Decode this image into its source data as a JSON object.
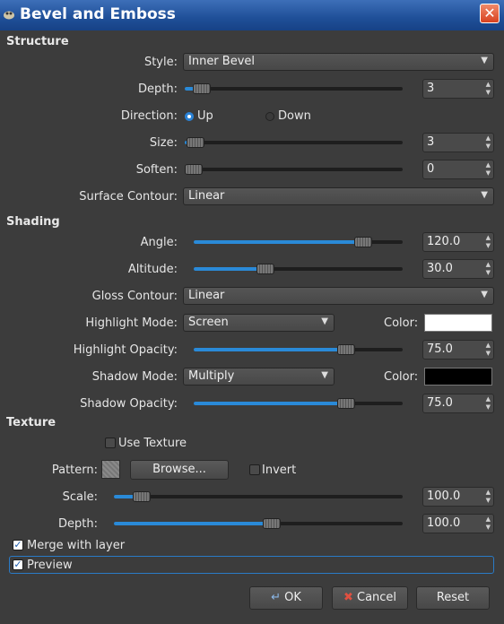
{
  "window": {
    "title": "Bevel and Emboss",
    "close_label": "✕"
  },
  "structure": {
    "heading": "Structure",
    "style_label": "Style:",
    "style_value": "Inner Bevel",
    "depth_label": "Depth:",
    "depth_value": "3",
    "depth_fraction": 0.04,
    "direction_label": "Direction:",
    "direction_up": "Up",
    "direction_down": "Down",
    "direction_selected": "Up",
    "size_label": "Size:",
    "size_value": "3",
    "size_fraction": 0.01,
    "soften_label": "Soften:",
    "soften_value": "0",
    "soften_fraction": 0.0,
    "surface_contour_label": "Surface Contour:",
    "surface_contour_value": "Linear"
  },
  "shading": {
    "heading": "Shading",
    "angle_label": "Angle:",
    "angle_value": "120.0",
    "angle_fraction": 0.84,
    "altitude_label": "Altitude:",
    "altitude_value": "30.0",
    "altitude_fraction": 0.33,
    "gloss_contour_label": "Gloss Contour:",
    "gloss_contour_value": "Linear",
    "highlight_mode_label": "Highlight Mode:",
    "highlight_mode_value": "Screen",
    "highlight_color_label": "Color:",
    "highlight_color": "#ffffff",
    "highlight_opacity_label": "Highlight Opacity:",
    "highlight_opacity_value": "75.0",
    "highlight_opacity_fraction": 0.75,
    "shadow_mode_label": "Shadow Mode:",
    "shadow_mode_value": "Multiply",
    "shadow_color_label": "Color:",
    "shadow_color": "#000000",
    "shadow_opacity_label": "Shadow Opacity:",
    "shadow_opacity_value": "75.0",
    "shadow_opacity_fraction": 0.75
  },
  "texture": {
    "heading": "Texture",
    "use_texture_label": "Use Texture",
    "use_texture_checked": false,
    "pattern_label": "Pattern:",
    "browse_label": "Browse...",
    "invert_label": "Invert",
    "invert_checked": false,
    "scale_label": "Scale:",
    "scale_value": "100.0",
    "scale_fraction": 0.07,
    "depth_label": "Depth:",
    "depth_value": "100.0",
    "depth_fraction": 0.55
  },
  "options": {
    "merge_label": "Merge with layer",
    "merge_checked": true,
    "preview_label": "Preview",
    "preview_checked": true
  },
  "buttons": {
    "ok": "OK",
    "cancel": "Cancel",
    "reset": "Reset"
  },
  "colors": {
    "accent": "#2a8ad8",
    "titlebar": "#1f4f98"
  }
}
